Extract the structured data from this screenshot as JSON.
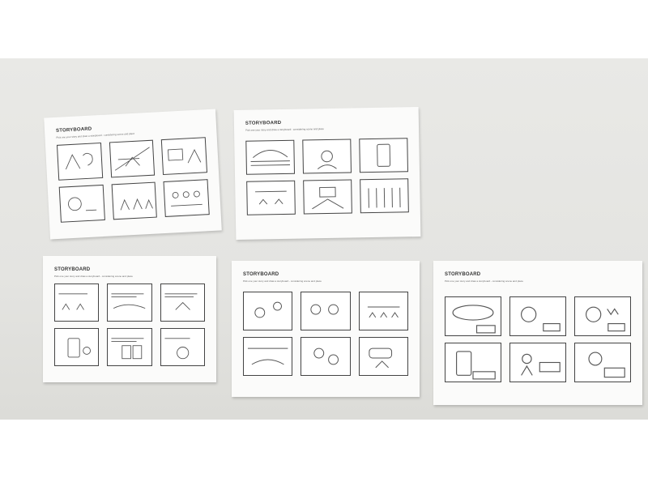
{
  "wall_color": "#e6e6e3",
  "paper_color": "#fbfbfa",
  "sheets": [
    {
      "title": "STORYBOARD",
      "subtitle": "Pick one your story and draw a storyboard - considering scene and place"
    },
    {
      "title": "STORYBOARD",
      "subtitle": "Pick one your story and draw a storyboard - considering scene and place"
    },
    {
      "title": "STORYBOARD",
      "subtitle": "Pick one your story and draw a storyboard - considering scene and place"
    },
    {
      "title": "STORYBOARD",
      "subtitle": "Pick one your story and draw a storyboard - considering scene and place"
    },
    {
      "title": "STORYBOARD",
      "subtitle": "Pick one your story and draw a storyboard - considering scene and place"
    }
  ]
}
